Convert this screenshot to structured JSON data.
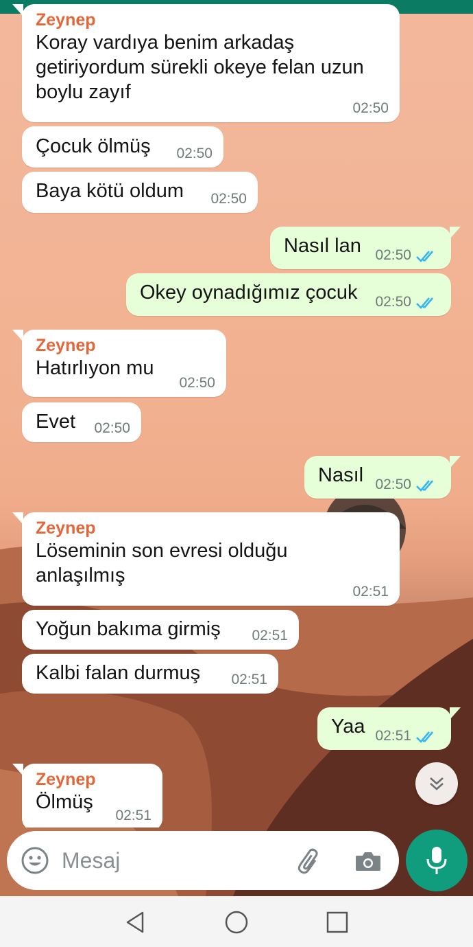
{
  "chat": {
    "messages": [
      {
        "dir": "in",
        "sender": "Zeynep",
        "text": "Koray vardıya benim arkadaş getiriyordum sürekli okeye felan uzun boylu zayıf",
        "time": "02:50"
      },
      {
        "dir": "in",
        "text": "Çocuk ölmüş",
        "time": "02:50"
      },
      {
        "dir": "in",
        "text": "Baya kötü oldum",
        "time": "02:50"
      },
      {
        "dir": "out",
        "text": "Nasıl lan",
        "time": "02:50",
        "status": "read"
      },
      {
        "dir": "out",
        "text": "Okey oynadığımız çocuk",
        "time": "02:50",
        "status": "read"
      },
      {
        "dir": "in",
        "sender": "Zeynep",
        "text": "Hatırlıyon mu",
        "time": "02:50"
      },
      {
        "dir": "in",
        "text": "Evet",
        "time": "02:50"
      },
      {
        "dir": "out",
        "text": "Nasıl",
        "time": "02:50",
        "status": "read"
      },
      {
        "dir": "in",
        "sender": "Zeynep",
        "text": "Löseminin son evresi olduğu anlaşılmış",
        "time": "02:51"
      },
      {
        "dir": "in",
        "text": "Yoğun bakıma girmiş",
        "time": "02:51"
      },
      {
        "dir": "in",
        "text": "Kalbi falan durmuş",
        "time": "02:51"
      },
      {
        "dir": "out",
        "text": "Yaa",
        "time": "02:51",
        "status": "read"
      },
      {
        "dir": "in",
        "sender": "Zeynep",
        "text": "Ölmüş",
        "time": "02:51"
      }
    ]
  },
  "input": {
    "placeholder": "Mesaj"
  },
  "icons": {
    "emoji": "emoji-icon",
    "attach": "paperclip-icon",
    "camera": "camera-icon",
    "mic": "mic-icon",
    "scroll": "double-chevron-down-icon",
    "read_receipt": "double-check-icon",
    "nav_back": "triangle-back-icon",
    "nav_home": "circle-home-icon",
    "nav_recents": "square-recents-icon"
  },
  "colors": {
    "header": "#0c7b64",
    "incoming_bubble": "#ffffff",
    "outgoing_bubble": "#e6ffd9",
    "sender_name": "#e2673a",
    "read_tick": "#34b7f1",
    "mic_button": "#0f9d7d"
  }
}
